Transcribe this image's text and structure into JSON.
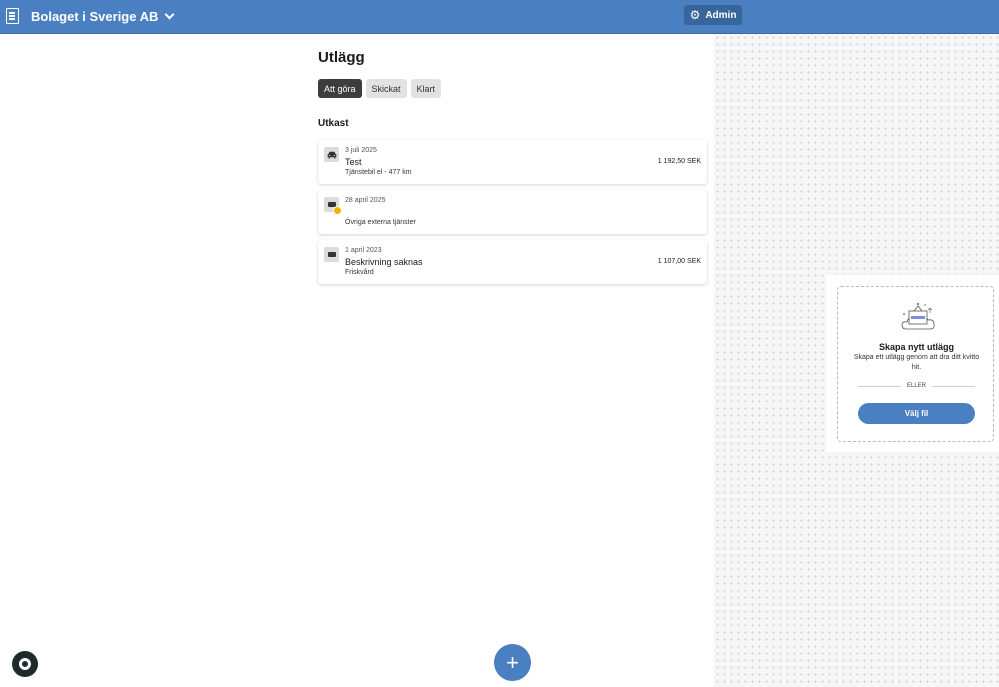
{
  "header": {
    "company_name": "Bolaget i Sverige AB",
    "admin_label": "Admin",
    "icons": {
      "app": "document-list-icon",
      "dropdown": "chevron-down-icon",
      "admin": "gear-icon"
    },
    "colors": {
      "bar": "#4a7fc1",
      "admin_button": "#38659b"
    }
  },
  "main": {
    "title": "Utlägg",
    "tabs": [
      {
        "label": "Att göra",
        "active": true
      },
      {
        "label": "Skickat",
        "active": false
      },
      {
        "label": "Klart",
        "active": false
      }
    ],
    "section_title": "Utkast",
    "expenses": [
      {
        "date": "3 juli 2025",
        "title": "Test",
        "subtitle": "Tjänstebil el - 477 km",
        "amount": "1 192,50 SEK",
        "icon": "car-icon",
        "warning": false
      },
      {
        "date": "28 april 2025",
        "title": "",
        "subtitle": "Övriga externa tjänster",
        "amount": "",
        "icon": "receipt-icon",
        "warning": true
      },
      {
        "date": "1 april 2023",
        "title": "Beskrivning saknas",
        "subtitle": "Friskvård",
        "amount": "1 107,00 SEK",
        "icon": "receipt-icon",
        "warning": false
      }
    ]
  },
  "upload": {
    "title": "Skapa nytt utlägg",
    "text": "Skapa ett utlägg genom att dra ditt kvitto hit.",
    "or_label": "ELLER",
    "button_label": "Välj fil"
  },
  "fab": {
    "label": "+",
    "icon": "plus-icon"
  },
  "help": {
    "icon": "lifebuoy-icon"
  },
  "colors": {
    "accent": "#4a7fc1",
    "warning": "#f0b400",
    "active_tab": "#3d3d3d"
  }
}
